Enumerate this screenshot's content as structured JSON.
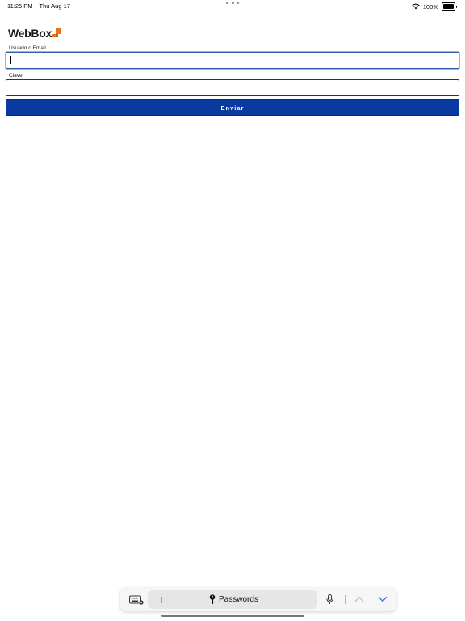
{
  "status_bar": {
    "time": "11:25 PM",
    "date": "Thu Aug 17",
    "battery": "100%"
  },
  "logo": {
    "text": "WebBox",
    "accent_color": "#e8731a"
  },
  "form": {
    "username_label": "Usuario o Email",
    "username_value": "",
    "password_label": "Clave",
    "password_value": "",
    "submit_label": "Enviar",
    "submit_color": "#0a3aa0"
  },
  "keyboard_bar": {
    "passwords_label": "Passwords",
    "icons": [
      "keyboard-hide-icon",
      "key-icon",
      "microphone-icon",
      "chevron-up-icon",
      "chevron-down-icon"
    ]
  }
}
